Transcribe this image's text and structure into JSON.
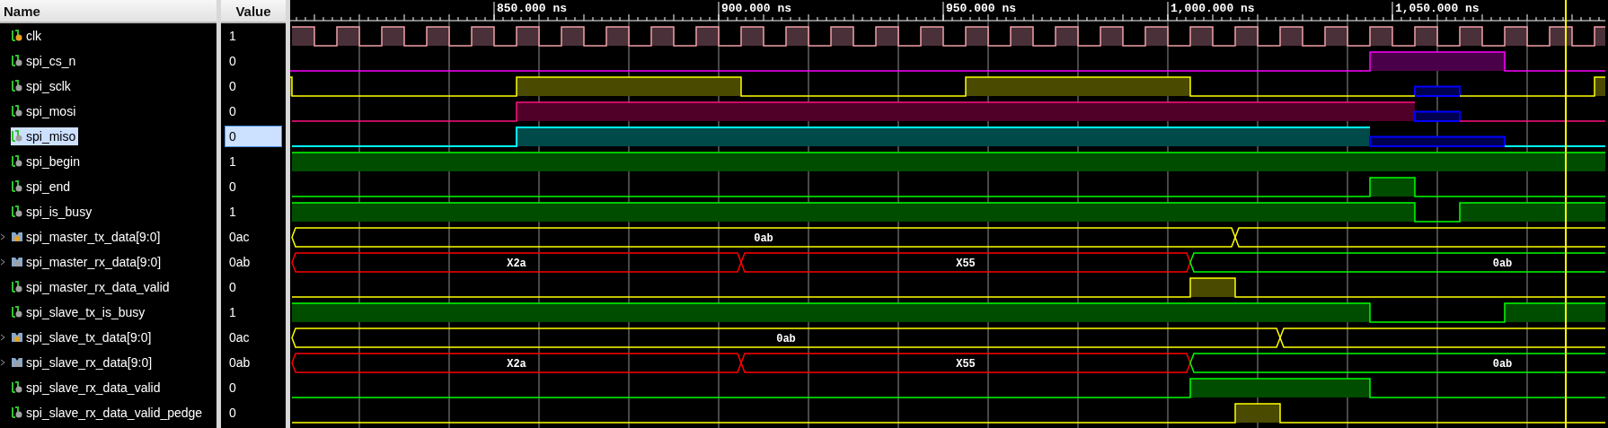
{
  "columns": {
    "name": "Name",
    "value": "Value"
  },
  "timeline": {
    "labels": [
      "850.000 ns",
      "900.000 ns",
      "950.000 ns",
      "1,000.000 ns",
      "1,050.000 ns"
    ]
  },
  "signals": [
    {
      "name": "clk",
      "kind": "bit",
      "color": "#e8a020",
      "value": "1",
      "selected": false
    },
    {
      "name": "spi_cs_n",
      "kind": "bit",
      "color": "#a0a0a0",
      "value": "0",
      "selected": false
    },
    {
      "name": "spi_sclk",
      "kind": "bit",
      "color": "#a0a0a0",
      "value": "0",
      "selected": false
    },
    {
      "name": "spi_mosi",
      "kind": "bit",
      "color": "#a0a0a0",
      "value": "0",
      "selected": false
    },
    {
      "name": "spi_miso",
      "kind": "bit",
      "color": "#a0a0a0",
      "value": "0",
      "selected": true
    },
    {
      "name": "spi_begin",
      "kind": "bit",
      "color": "#a0a0a0",
      "value": "1",
      "selected": false
    },
    {
      "name": "spi_end",
      "kind": "bit",
      "color": "#a0a0a0",
      "value": "0",
      "selected": false
    },
    {
      "name": "spi_is_busy",
      "kind": "bit",
      "color": "#a0a0a0",
      "value": "1",
      "selected": false
    },
    {
      "name": "spi_master_tx_data[9:0]",
      "kind": "bus",
      "color": "#e8a020",
      "value": "0ac",
      "selected": false,
      "segment_labels": [
        "0ab"
      ]
    },
    {
      "name": "spi_master_rx_data[9:0]",
      "kind": "bus",
      "color": "#a0a0a0",
      "value": "0ab",
      "selected": false,
      "segment_labels": [
        "X2a",
        "X55",
        "0ab"
      ]
    },
    {
      "name": "spi_master_rx_data_valid",
      "kind": "bit",
      "color": "#a0a0a0",
      "value": "0",
      "selected": false
    },
    {
      "name": "spi_slave_tx_is_busy",
      "kind": "bit",
      "color": "#a0a0a0",
      "value": "1",
      "selected": false
    },
    {
      "name": "spi_slave_tx_data[9:0]",
      "kind": "bus",
      "color": "#e8a020",
      "value": "0ac",
      "selected": false,
      "segment_labels": [
        "0ab"
      ]
    },
    {
      "name": "spi_slave_rx_data[9:0]",
      "kind": "bus",
      "color": "#a0a0a0",
      "value": "0ab",
      "selected": false,
      "segment_labels": [
        "X2a",
        "X55",
        "0ab"
      ]
    },
    {
      "name": "spi_slave_rx_data_valid",
      "kind": "bit",
      "color": "#a0a0a0",
      "value": "0",
      "selected": false
    },
    {
      "name": "spi_slave_rx_data_valid_pedge",
      "kind": "bit",
      "color": "#a0a0a0",
      "value": "0",
      "selected": false
    }
  ]
}
